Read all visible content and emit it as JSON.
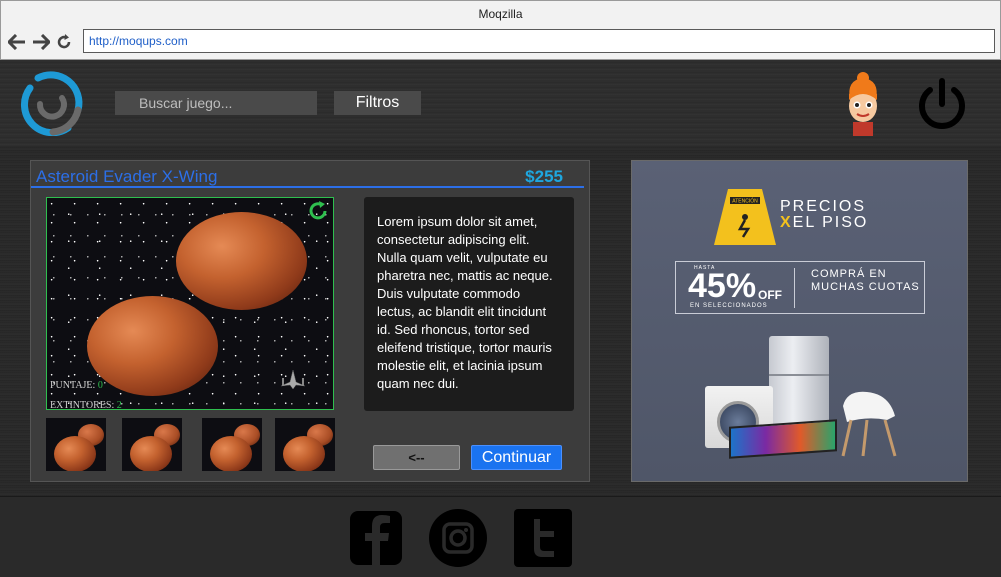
{
  "browser": {
    "window_title": "Moqzilla",
    "url": "http://moqups.com"
  },
  "header": {
    "search_placeholder": "Buscar juego...",
    "filters_label": "Filtros"
  },
  "game": {
    "title": "Asteroid Evader X-Wing",
    "price": "$255",
    "hud": {
      "score_label": "PUNTAJE:",
      "score_value": "0",
      "extinguishers_label": "EXTINTORES:",
      "extinguishers_value": "2"
    },
    "description": "Lorem ipsum dolor sit amet, consectetur adipiscing elit. Nulla quam velit, vulputate eu pharetra nec, mattis ac neque. Duis vulputate commodo lectus, ac blandit elit tincidunt id. Sed rhoncus, tortor sed eleifend tristique, tortor mauris molestie elit, et lacinia ipsum quam nec dui.",
    "back_label": "<--",
    "continue_label": "Continuar"
  },
  "ad": {
    "sign_text": "ATENCIÓN",
    "headline_1": "PRECIOS",
    "headline_x": "X",
    "headline_2": "EL PISO",
    "hasta": "HASTA",
    "percent": "45%",
    "off": "OFF",
    "en_seleccionados": "EN SELECCIONADOS",
    "compra": "COMPRÁ EN MUCHAS CUOTAS"
  },
  "footer": {
    "icons": [
      "facebook-icon",
      "instagram-icon",
      "twitter-icon"
    ]
  },
  "colors": {
    "accent_blue": "#2c6fe8",
    "price_blue": "#1ea7e0",
    "continue_blue": "#1a73f0",
    "hud_green": "#2fbf4f"
  }
}
